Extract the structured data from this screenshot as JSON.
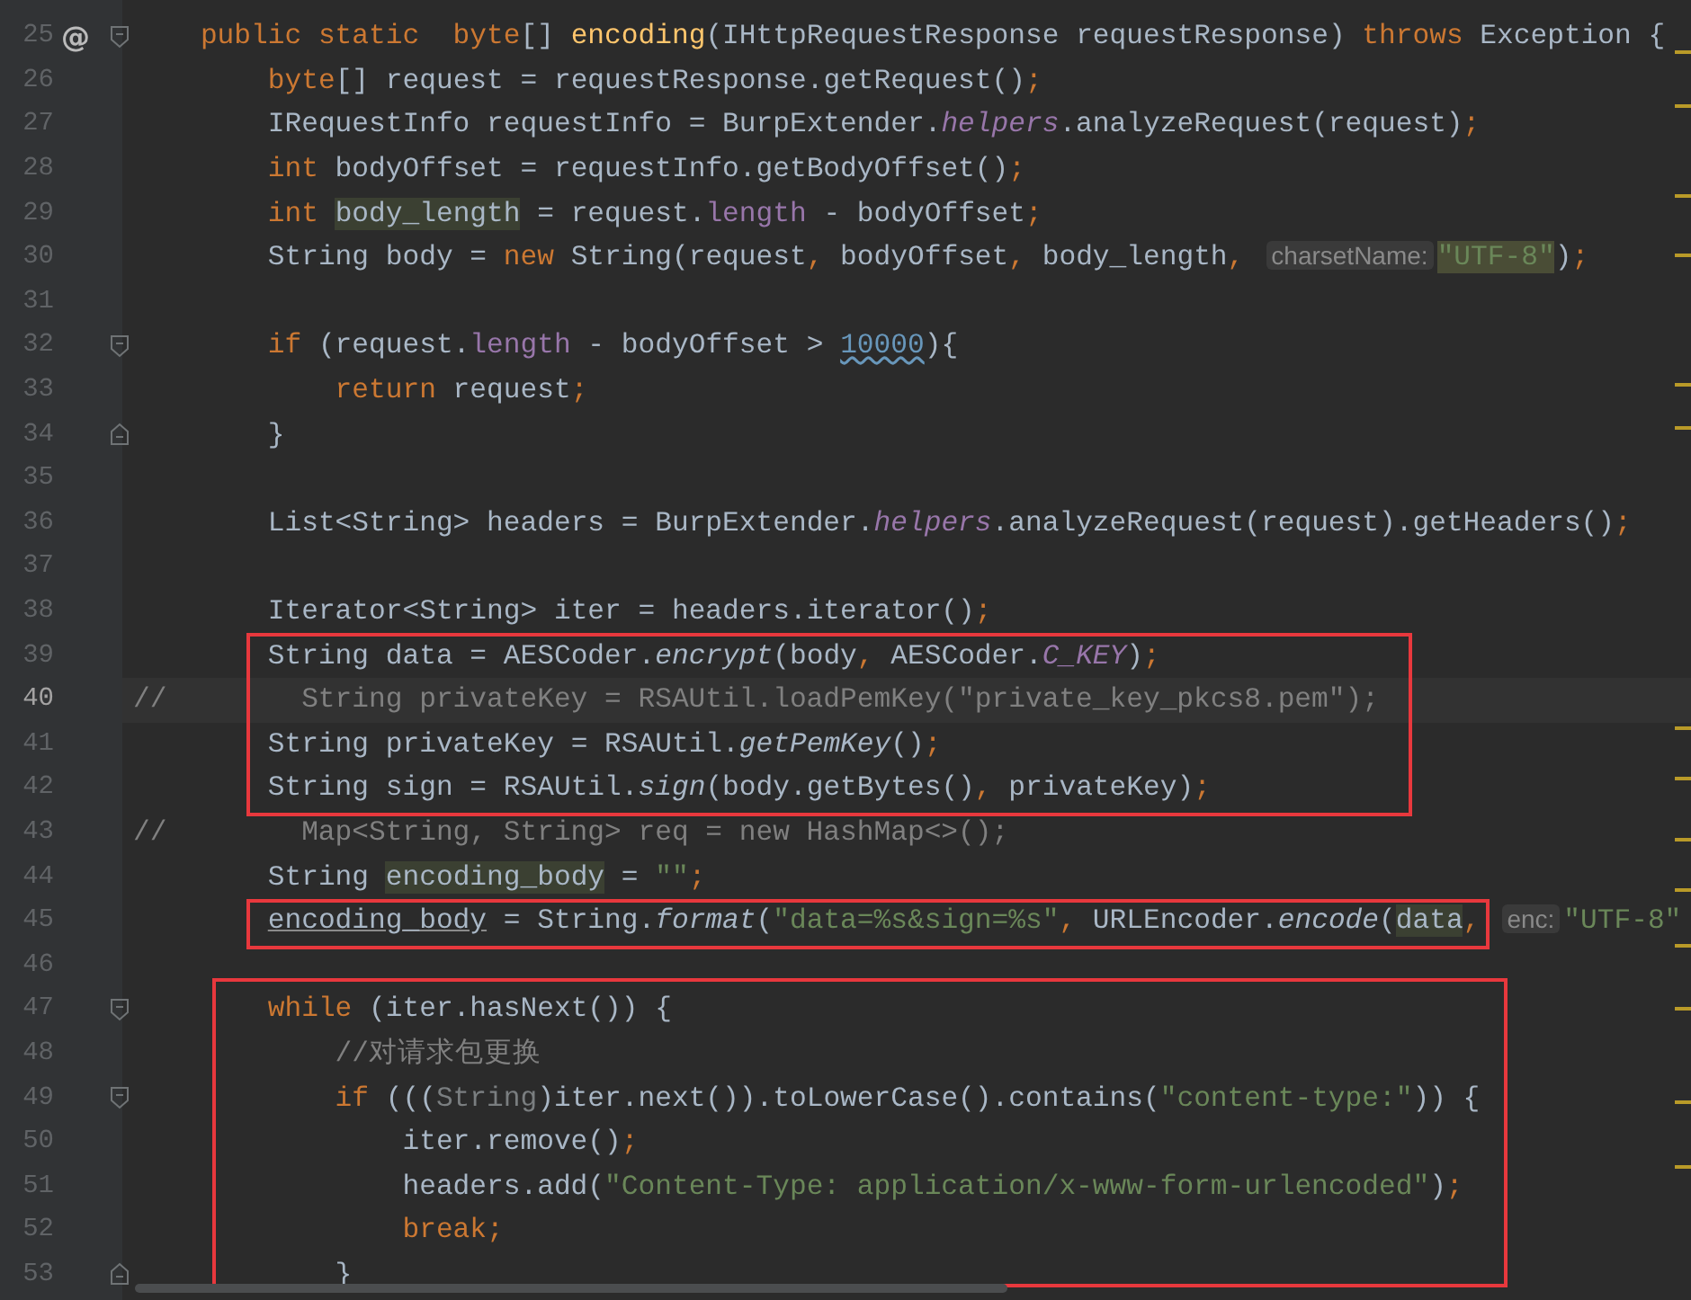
{
  "editor": {
    "lines": [
      {
        "kind": "line",
        "number": "25",
        "marker": "@",
        "fold": {
          "kind": "start"
        },
        "current": false,
        "tokens": [
          {
            "text": "    public static  byte",
            "kind": "kw"
          },
          {
            "text": "[] ",
            "kind": "txt"
          },
          {
            "text": "encoding",
            "kind": "decl"
          },
          {
            "text": "(IHttpRequestResponse requestResponse) ",
            "kind": "txt"
          },
          {
            "text": "throws",
            "kind": "kw"
          },
          {
            "text": " Exception {",
            "kind": "txt"
          }
        ]
      },
      {
        "kind": "line",
        "number": "26",
        "current": false,
        "tokens": [
          {
            "text": "        byte",
            "kind": "kw"
          },
          {
            "text": "[] request = requestResponse.getRequest()",
            "kind": "txt"
          },
          {
            "text": ";",
            "kind": "punc"
          }
        ]
      },
      {
        "kind": "line",
        "number": "27",
        "current": false,
        "tokens": [
          {
            "text": "        IRequestInfo requestInfo = BurpExtender.",
            "kind": "txt"
          },
          {
            "text": "helpers",
            "kind": "fld"
          },
          {
            "text": ".analyzeRequest(request)",
            "kind": "txt"
          },
          {
            "text": ";",
            "kind": "punc"
          }
        ]
      },
      {
        "kind": "line",
        "number": "28",
        "current": false,
        "tokens": [
          {
            "text": "        int",
            "kind": "kw"
          },
          {
            "text": " bodyOffset = requestInfo.getBodyOffset()",
            "kind": "txt"
          },
          {
            "text": ";",
            "kind": "punc"
          }
        ]
      },
      {
        "kind": "line",
        "number": "29",
        "current": false,
        "tokens": [
          {
            "text": "        int ",
            "kind": "kw"
          },
          {
            "text": "body_length",
            "kind": "usage"
          },
          {
            "text": " = request.",
            "kind": "txt"
          },
          {
            "text": "length",
            "kind": "prop"
          },
          {
            "text": " - bodyOffset",
            "kind": "txt"
          },
          {
            "text": ";",
            "kind": "punc"
          }
        ]
      },
      {
        "kind": "line",
        "number": "30",
        "current": false,
        "tokens": [
          {
            "text": "        String body = ",
            "kind": "txt"
          },
          {
            "text": "new",
            "kind": "kw"
          },
          {
            "text": " String(request",
            "kind": "txt"
          },
          {
            "text": ",",
            "kind": "punc"
          },
          {
            "text": " bodyOffset",
            "kind": "txt"
          },
          {
            "text": ",",
            "kind": "punc"
          },
          {
            "text": " body_length",
            "kind": "txt"
          },
          {
            "text": ",",
            "kind": "punc"
          },
          {
            "text": "charsetName:",
            "kind": "hint"
          },
          {
            "text": "\"UTF-8\"",
            "kind": "strusage"
          },
          {
            "text": ")",
            "kind": "txt"
          },
          {
            "text": ";",
            "kind": "punc"
          }
        ]
      },
      {
        "kind": "line",
        "number": "31",
        "current": false
      },
      {
        "kind": "line",
        "number": "32",
        "fold": {
          "kind": "start"
        },
        "current": false,
        "tokens": [
          {
            "text": "        if",
            "kind": "kw"
          },
          {
            "text": " (request.",
            "kind": "txt"
          },
          {
            "text": "length",
            "kind": "prop"
          },
          {
            "text": " - bodyOffset > ",
            "kind": "txt"
          },
          {
            "text": "10000",
            "kind": "numwarn"
          },
          {
            "text": "){",
            "kind": "txt"
          }
        ]
      },
      {
        "kind": "line",
        "number": "33",
        "current": false,
        "tokens": [
          {
            "text": "            return",
            "kind": "kw"
          },
          {
            "text": " request",
            "kind": "txt"
          },
          {
            "text": ";",
            "kind": "punc"
          }
        ]
      },
      {
        "kind": "line",
        "number": "34",
        "fold": {
          "kind": "end"
        },
        "current": false,
        "tokens": [
          {
            "text": "        }",
            "kind": "txt"
          }
        ]
      },
      {
        "kind": "line",
        "number": "35",
        "current": false
      },
      {
        "kind": "line",
        "number": "36",
        "current": false,
        "tokens": [
          {
            "text": "        List<String> headers = BurpExtender.",
            "kind": "txt"
          },
          {
            "text": "helpers",
            "kind": "fld"
          },
          {
            "text": ".analyzeRequest(request).getHeaders()",
            "kind": "txt"
          },
          {
            "text": ";",
            "kind": "punc"
          }
        ]
      },
      {
        "kind": "line",
        "number": "37",
        "current": false
      },
      {
        "kind": "line",
        "number": "38",
        "current": false,
        "tokens": [
          {
            "text": "        Iterator<String> iter = headers.iterator()",
            "kind": "txt"
          },
          {
            "text": ";",
            "kind": "punc"
          }
        ]
      },
      {
        "kind": "boxed-group",
        "lines": [
          {
            "kind": "line",
            "number": "39",
            "current": false,
            "tokens": [
              {
                "text": "        String data = AESCoder.",
                "kind": "txt"
              },
              {
                "text": "encrypt",
                "kind": "ital"
              },
              {
                "text": "(body",
                "kind": "txt"
              },
              {
                "text": ",",
                "kind": "punc"
              },
              {
                "text": " AESCoder.",
                "kind": "txt"
              },
              {
                "text": "C_KEY",
                "kind": "fld"
              },
              {
                "text": ")",
                "kind": "txt"
              },
              {
                "text": ";",
                "kind": "punc"
              }
            ]
          },
          {
            "kind": "line",
            "number": "40",
            "current": true,
            "tokens": [
              {
                "text": "//        String privateKey = RSAUtil.loadPemKey(\"private_key_pkcs8.pem\");",
                "kind": "cmt"
              }
            ]
          },
          {
            "kind": "line",
            "number": "41",
            "current": false,
            "tokens": [
              {
                "text": "        String privateKey = RSAUtil.",
                "kind": "txt"
              },
              {
                "text": "getPemKey",
                "kind": "ital"
              },
              {
                "text": "()",
                "kind": "txt"
              },
              {
                "text": ";",
                "kind": "punc"
              }
            ]
          },
          {
            "kind": "line",
            "number": "42",
            "current": false,
            "tokens": [
              {
                "text": "        String sign = RSAUtil.",
                "kind": "txt"
              },
              {
                "text": "sign",
                "kind": "ital"
              },
              {
                "text": "(body.getBytes()",
                "kind": "txt"
              },
              {
                "text": ",",
                "kind": "punc"
              },
              {
                "text": " privateKey)",
                "kind": "txt"
              },
              {
                "text": ";",
                "kind": "punc"
              }
            ]
          }
        ]
      },
      {
        "kind": "line",
        "number": "43",
        "current": false,
        "tokens": [
          {
            "text": "//        Map<String, String> req = new HashMap<>();",
            "kind": "cmt"
          }
        ]
      },
      {
        "kind": "line",
        "number": "44",
        "current": false,
        "tokens": [
          {
            "text": "        String ",
            "kind": "txt"
          },
          {
            "text": "encoding_body",
            "kind": "usage"
          },
          {
            "text": " = ",
            "kind": "txt"
          },
          {
            "text": "\"\"",
            "kind": "str"
          },
          {
            "text": ";",
            "kind": "punc"
          }
        ]
      },
      {
        "kind": "boxed-group",
        "lines": [
          {
            "kind": "line",
            "number": "45",
            "current": false,
            "tokens": [
              {
                "text": "        encoding_body",
                "kind": "under"
              },
              {
                "text": " = String.",
                "kind": "txt"
              },
              {
                "text": "format",
                "kind": "ital"
              },
              {
                "text": "(",
                "kind": "txt"
              },
              {
                "text": "\"data=%s&sign=%s\"",
                "kind": "str"
              },
              {
                "text": ",",
                "kind": "punc"
              },
              {
                "text": " URLEncoder.",
                "kind": "txt"
              },
              {
                "text": "encode",
                "kind": "ital"
              },
              {
                "text": "(",
                "kind": "txt"
              },
              {
                "text": "data",
                "kind": "usage"
              },
              {
                "text": ",",
                "kind": "punc"
              },
              {
                "text": "enc:",
                "kind": "hint"
              },
              {
                "text": "\"UTF-8\"",
                "kind": "str"
              }
            ]
          }
        ]
      },
      {
        "kind": "line",
        "number": "46",
        "current": false
      },
      {
        "kind": "boxed-group",
        "lines": [
          {
            "kind": "line",
            "number": "47",
            "fold": {
              "kind": "start"
            },
            "current": false,
            "tokens": [
              {
                "text": "        while",
                "kind": "kw"
              },
              {
                "text": " (iter.hasNext()) {",
                "kind": "txt"
              }
            ]
          },
          {
            "kind": "line",
            "number": "48",
            "current": false,
            "tokens": [
              {
                "text": "            //对请求包更换",
                "kind": "cmt"
              }
            ]
          },
          {
            "kind": "line",
            "number": "49",
            "fold": {
              "kind": "start"
            },
            "current": false,
            "tokens": [
              {
                "text": "            if",
                "kind": "kw"
              },
              {
                "text": " (((",
                "kind": "txt"
              },
              {
                "text": "String",
                "kind": "dim"
              },
              {
                "text": ")iter.next()).toLowerCase().contains(",
                "kind": "txt"
              },
              {
                "text": "\"content-type:\"",
                "kind": "str"
              },
              {
                "text": ")) {",
                "kind": "txt"
              }
            ]
          },
          {
            "kind": "line",
            "number": "50",
            "current": false,
            "tokens": [
              {
                "text": "                iter.remove()",
                "kind": "txt"
              },
              {
                "text": ";",
                "kind": "punc"
              }
            ]
          },
          {
            "kind": "line",
            "number": "51",
            "current": false,
            "tokens": [
              {
                "text": "                headers.add(",
                "kind": "txt"
              },
              {
                "text": "\"Content-Type: application/x-www-form-urlencoded\"",
                "kind": "str"
              },
              {
                "text": ")",
                "kind": "txt"
              },
              {
                "text": ";",
                "kind": "punc"
              }
            ]
          },
          {
            "kind": "line",
            "number": "52",
            "current": false,
            "tokens": [
              {
                "text": "                break",
                "kind": "kw"
              },
              {
                "text": ";",
                "kind": "punc"
              }
            ]
          },
          {
            "kind": "line",
            "number": "53",
            "fold": {
              "kind": "end"
            },
            "current": false,
            "tokens": [
              {
                "text": "            }",
                "kind": "txt"
              }
            ]
          }
        ]
      }
    ]
  }
}
